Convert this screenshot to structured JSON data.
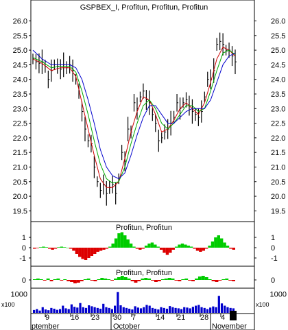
{
  "colors": {
    "background": "#ffffff",
    "panel_border": "#000000",
    "price_bar": "#000000",
    "ma_fast": "#cc0000",
    "ma_mid": "#00aa00",
    "ma_slow": "#0000cc",
    "osc_positive": "#00cc00",
    "osc_negative": "#dd0000",
    "volume": "#0000cc"
  },
  "chart_data": [
    {
      "panel": "price",
      "type": "line",
      "title": "GSPBEX_I, Profitun, Profitun, Profitun",
      "y_ticks": [
        19.5,
        20.0,
        20.5,
        21.0,
        21.5,
        22.0,
        22.5,
        23.0,
        23.5,
        24.0,
        24.5,
        25.0,
        25.5,
        26.0
      ],
      "ylim": [
        19.25,
        26.2
      ],
      "x_ticks": [
        "9",
        "16",
        "23",
        "30",
        "7",
        "14",
        "21",
        "28",
        "4"
      ],
      "x_months": [
        "ptember",
        "October",
        "November"
      ],
      "series": [
        {
          "style": "ohlc-bars",
          "points": [
            [
              0,
              24.7
            ],
            [
              2,
              24.6
            ],
            [
              4,
              24.55
            ],
            [
              6,
              24.6
            ],
            [
              8,
              24.45
            ],
            [
              10,
              24.0
            ],
            [
              12,
              24.3
            ],
            [
              14,
              24.5
            ],
            [
              16,
              24.45
            ],
            [
              18,
              24.35
            ],
            [
              20,
              24.5
            ],
            [
              22,
              24.4
            ],
            [
              24,
              24.5
            ],
            [
              26,
              24.3
            ],
            [
              28,
              24.0
            ],
            [
              30,
              23.6
            ],
            [
              32,
              22.9
            ],
            [
              34,
              22.3
            ],
            [
              36,
              21.9
            ],
            [
              38,
              21.8
            ],
            [
              40,
              21.0
            ],
            [
              42,
              20.5
            ],
            [
              44,
              20.2
            ],
            [
              46,
              20.4
            ],
            [
              48,
              20.1
            ],
            [
              50,
              20.3
            ],
            [
              52,
              20.4
            ],
            [
              54,
              20.1
            ],
            [
              56,
              20.6
            ],
            [
              58,
              21.5
            ],
            [
              60,
              21.2
            ],
            [
              62,
              22.3
            ],
            [
              64,
              22.2
            ],
            [
              66,
              23.2
            ],
            [
              68,
              23.0
            ],
            [
              70,
              23.4
            ],
            [
              72,
              23.6
            ],
            [
              74,
              23.3
            ],
            [
              76,
              23.2
            ],
            [
              78,
              22.8
            ],
            [
              80,
              22.5
            ],
            [
              82,
              21.9
            ],
            [
              84,
              22.0
            ],
            [
              86,
              22.2
            ],
            [
              88,
              22.3
            ],
            [
              90,
              22.5
            ],
            [
              92,
              22.7
            ],
            [
              94,
              23.2
            ],
            [
              96,
              23.0
            ],
            [
              98,
              23.2
            ],
            [
              100,
              23.3
            ],
            [
              102,
              23.1
            ],
            [
              104,
              22.9
            ],
            [
              106,
              22.8
            ],
            [
              108,
              22.7
            ],
            [
              110,
              22.9
            ],
            [
              112,
              23.4
            ],
            [
              114,
              24.0
            ],
            [
              116,
              24.0
            ],
            [
              118,
              24.3
            ],
            [
              120,
              25.2
            ],
            [
              122,
              25.3
            ],
            [
              124,
              25.2
            ],
            [
              126,
              25.0
            ],
            [
              128,
              25.0
            ],
            [
              130,
              24.8
            ],
            [
              132,
              24.6
            ]
          ]
        },
        {
          "name": "",
          "color_key": "ma_fast",
          "points": [
            [
              0,
              24.7
            ],
            [
              6,
              24.55
            ],
            [
              12,
              24.3
            ],
            [
              18,
              24.4
            ],
            [
              24,
              24.4
            ],
            [
              28,
              24.1
            ],
            [
              32,
              23.2
            ],
            [
              36,
              22.3
            ],
            [
              40,
              21.4
            ],
            [
              44,
              20.6
            ],
            [
              48,
              20.3
            ],
            [
              52,
              20.3
            ],
            [
              56,
              20.5
            ],
            [
              60,
              21.3
            ],
            [
              64,
              22.2
            ],
            [
              68,
              22.9
            ],
            [
              72,
              23.4
            ],
            [
              76,
              23.3
            ],
            [
              80,
              22.8
            ],
            [
              84,
              22.2
            ],
            [
              88,
              22.3
            ],
            [
              92,
              22.6
            ],
            [
              96,
              23.0
            ],
            [
              100,
              23.2
            ],
            [
              104,
              23.0
            ],
            [
              108,
              22.8
            ],
            [
              112,
              23.2
            ],
            [
              116,
              23.9
            ],
            [
              120,
              24.7
            ],
            [
              124,
              25.1
            ],
            [
              128,
              25.0
            ],
            [
              132,
              24.8
            ]
          ]
        },
        {
          "name": "",
          "color_key": "ma_mid",
          "points": [
            [
              0,
              24.75
            ],
            [
              6,
              24.6
            ],
            [
              12,
              24.4
            ],
            [
              18,
              24.45
            ],
            [
              24,
              24.45
            ],
            [
              28,
              24.25
            ],
            [
              32,
              23.6
            ],
            [
              36,
              22.8
            ],
            [
              40,
              21.9
            ],
            [
              44,
              21.1
            ],
            [
              48,
              20.6
            ],
            [
              52,
              20.45
            ],
            [
              56,
              20.5
            ],
            [
              60,
              21.0
            ],
            [
              64,
              21.8
            ],
            [
              68,
              22.5
            ],
            [
              72,
              23.1
            ],
            [
              76,
              23.3
            ],
            [
              80,
              23.0
            ],
            [
              84,
              22.5
            ],
            [
              88,
              22.3
            ],
            [
              92,
              22.5
            ],
            [
              96,
              22.8
            ],
            [
              100,
              23.1
            ],
            [
              104,
              23.1
            ],
            [
              108,
              22.9
            ],
            [
              112,
              23.0
            ],
            [
              116,
              23.6
            ],
            [
              120,
              24.3
            ],
            [
              124,
              24.9
            ],
            [
              128,
              25.0
            ],
            [
              132,
              24.85
            ]
          ]
        },
        {
          "name": "",
          "color_key": "ma_slow",
          "points": [
            [
              0,
              25.0
            ],
            [
              6,
              24.7
            ],
            [
              12,
              24.5
            ],
            [
              18,
              24.5
            ],
            [
              24,
              24.5
            ],
            [
              28,
              24.4
            ],
            [
              32,
              24.0
            ],
            [
              36,
              23.3
            ],
            [
              40,
              22.5
            ],
            [
              44,
              21.6
            ],
            [
              48,
              21.0
            ],
            [
              52,
              20.7
            ],
            [
              56,
              20.6
            ],
            [
              60,
              20.8
            ],
            [
              64,
              21.4
            ],
            [
              68,
              22.1
            ],
            [
              72,
              22.7
            ],
            [
              76,
              23.1
            ],
            [
              80,
              23.1
            ],
            [
              84,
              22.8
            ],
            [
              88,
              22.5
            ],
            [
              92,
              22.5
            ],
            [
              96,
              22.7
            ],
            [
              100,
              22.9
            ],
            [
              104,
              23.0
            ],
            [
              108,
              23.0
            ],
            [
              112,
              23.0
            ],
            [
              116,
              23.3
            ],
            [
              120,
              23.9
            ],
            [
              124,
              24.5
            ],
            [
              128,
              24.8
            ],
            [
              132,
              24.9
            ]
          ]
        }
      ]
    },
    {
      "panel": "oscillator1",
      "type": "bar",
      "title": "Profitun, Profitun",
      "y_ticks": [
        1,
        0,
        -1
      ],
      "ylim": [
        -1.6,
        1.6
      ],
      "values": [
        -0.1,
        -0.05,
        0.05,
        0.1,
        0.05,
        -0.1,
        -0.2,
        -0.1,
        0.05,
        0.1,
        0.05,
        0.0,
        -0.1,
        -0.3,
        -0.6,
        -0.9,
        -1.1,
        -1.2,
        -1.0,
        -0.8,
        -0.6,
        -0.4,
        -0.3,
        -0.2,
        -0.1,
        0.1,
        0.4,
        0.9,
        1.4,
        1.5,
        1.2,
        0.8,
        0.4,
        0.1,
        -0.1,
        -0.2,
        -0.1,
        0.2,
        0.4,
        0.5,
        0.3,
        0.1,
        -0.2,
        -0.5,
        -0.7,
        -0.5,
        -0.2,
        0.1,
        0.3,
        0.4,
        0.3,
        0.2,
        0.1,
        -0.1,
        -0.3,
        -0.4,
        -0.3,
        -0.1,
        0.2,
        0.6,
        1.0,
        1.2,
        0.9,
        0.5,
        0.2,
        -0.1,
        -0.2
      ]
    },
    {
      "panel": "oscillator2",
      "type": "bar",
      "title": "Profitun, Profitun",
      "y_ticks": [
        0
      ],
      "ylim": [
        -0.5,
        0.5
      ],
      "values": [
        0.05,
        0.1,
        0.05,
        -0.05,
        0.1,
        -0.1,
        0.05,
        0.1,
        -0.05,
        0.05,
        -0.1,
        -0.15,
        -0.25,
        -0.2,
        -0.1,
        0.05,
        0.1,
        -0.05,
        -0.1,
        0.05,
        0.15,
        0.1,
        0.05,
        -0.05,
        0.1,
        0.2,
        0.3,
        0.2,
        0.1,
        -0.1,
        -0.2,
        -0.1,
        0.1,
        0.15,
        0.1,
        -0.05,
        -0.15,
        -0.1,
        0.05,
        0.1,
        0.15,
        0.1,
        -0.05,
        -0.1,
        0.05,
        0.1,
        -0.05,
        -0.1,
        0.1,
        0.25,
        0.3,
        0.2,
        0.05,
        -0.1,
        -0.15,
        -0.05,
        0.05,
        0.1,
        -0.05,
        -0.1
      ]
    },
    {
      "panel": "volume",
      "type": "bar",
      "title": "",
      "y_label_left": "x100",
      "y_label_right": "x100",
      "y_ticks": [
        1000
      ],
      "ylim": [
        0,
        1200
      ],
      "values": [
        150,
        200,
        120,
        300,
        180,
        140,
        260,
        220,
        160,
        200,
        380,
        240,
        200,
        450,
        320,
        280,
        520,
        300,
        260,
        400,
        350,
        300,
        260,
        220,
        480,
        300,
        260,
        200,
        380,
        1100,
        400,
        300,
        260,
        220,
        180,
        350,
        280,
        240,
        300,
        420,
        380,
        260,
        220,
        180,
        300,
        260,
        220,
        360,
        300,
        260,
        240,
        200,
        300,
        280,
        240,
        320,
        380,
        420,
        300,
        260,
        200,
        280,
        340,
        300,
        900,
        500,
        380,
        300,
        260,
        240
      ]
    }
  ]
}
